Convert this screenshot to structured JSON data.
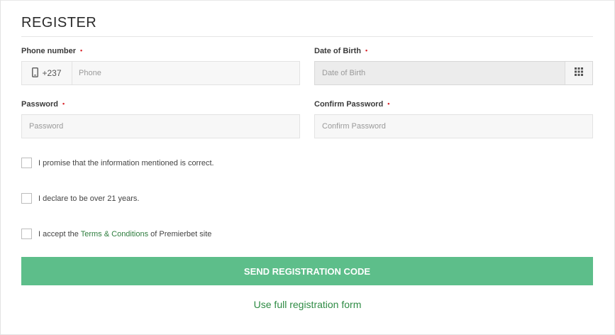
{
  "form": {
    "title": "REGISTER",
    "phone": {
      "label": "Phone number",
      "required_mark": "•",
      "country_code": "+237",
      "placeholder": "Phone"
    },
    "dob": {
      "label": "Date of Birth",
      "required_mark": "•",
      "placeholder": "Date of Birth"
    },
    "password": {
      "label": "Password",
      "required_mark": "•",
      "placeholder": "Password"
    },
    "confirm_password": {
      "label": "Confirm Password",
      "required_mark": "•",
      "placeholder": "Confirm Password"
    },
    "checks": [
      {
        "text": "I promise that the information mentioned is correct.",
        "checked": false
      },
      {
        "text": "I declare to be over 21 years.",
        "checked": false
      },
      {
        "text_before": "I accept the ",
        "link_text": "Terms & Conditions",
        "text_after": " of Premierbet site",
        "checked": false
      }
    ],
    "submit_label": "SEND REGISTRATION CODE",
    "alt_link": "Use full registration form"
  },
  "colors": {
    "accent_button": "#5dbe8a",
    "link": "#2e7d3e",
    "required": "#d9262c"
  },
  "icons": {
    "phone_prefix": "mobile-phone-icon",
    "calendar": "calendar-grid-icon"
  }
}
